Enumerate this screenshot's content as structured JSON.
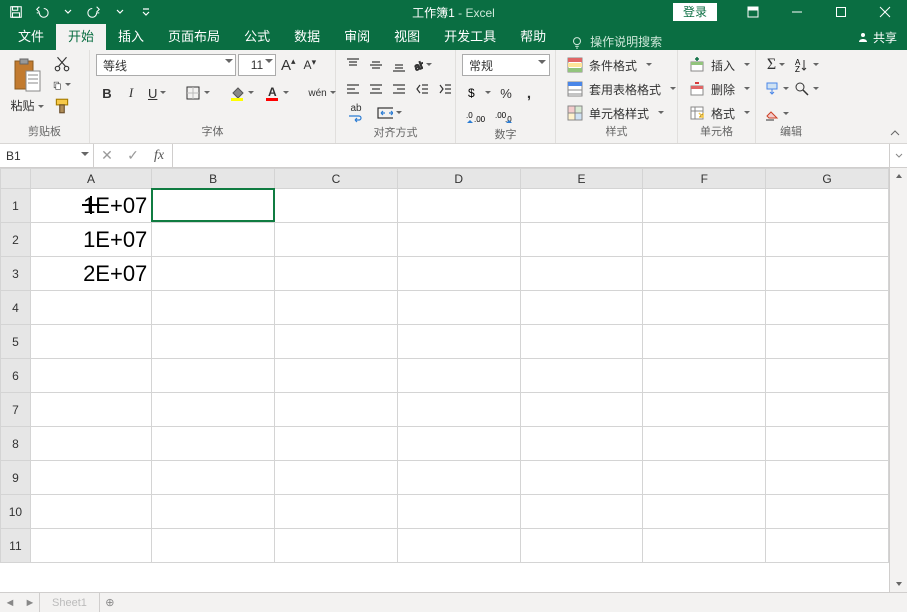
{
  "titlebar": {
    "document": "工作簿1",
    "separator": "  -  ",
    "app": "Excel",
    "login": "登录"
  },
  "tabs": {
    "file": "文件",
    "home": "开始",
    "insert": "插入",
    "layout": "页面布局",
    "formulas": "公式",
    "data": "数据",
    "review": "审阅",
    "view": "视图",
    "developer": "开发工具",
    "help": "帮助",
    "tellme": "操作说明搜索",
    "share": "共享"
  },
  "ribbon": {
    "clipboard": {
      "paste": "粘贴",
      "group": "剪贴板"
    },
    "font": {
      "name": "等线",
      "size": "11",
      "increase": "A",
      "decrease": "A",
      "bold": "B",
      "italic": "I",
      "underline": "U",
      "ruby": "wén",
      "group": "字体"
    },
    "align": {
      "wrap": "ab",
      "group": "对齐方式"
    },
    "number": {
      "format": "常规",
      "group": "数字"
    },
    "styles": {
      "conditional": "条件格式",
      "table": "套用表格格式",
      "cell": "单元格样式",
      "group": "样式"
    },
    "cells": {
      "insert": "插入",
      "delete": "删除",
      "format": "格式",
      "group": "单元格"
    },
    "editing": {
      "group": "编辑"
    }
  },
  "namebox": {
    "ref": "B1",
    "fx": "fx"
  },
  "grid": {
    "columns": [
      "A",
      "B",
      "C",
      "D",
      "E",
      "F",
      "G"
    ],
    "row_numbers": [
      "1",
      "2",
      "3",
      "4",
      "5",
      "6",
      "7",
      "8",
      "9",
      "10",
      "11"
    ],
    "cells": {
      "A1": "1E+07",
      "A2": "1E+07",
      "A3": "2E+07"
    },
    "active_cell": "B1"
  },
  "sheettab": {
    "name": "Sheet1"
  }
}
